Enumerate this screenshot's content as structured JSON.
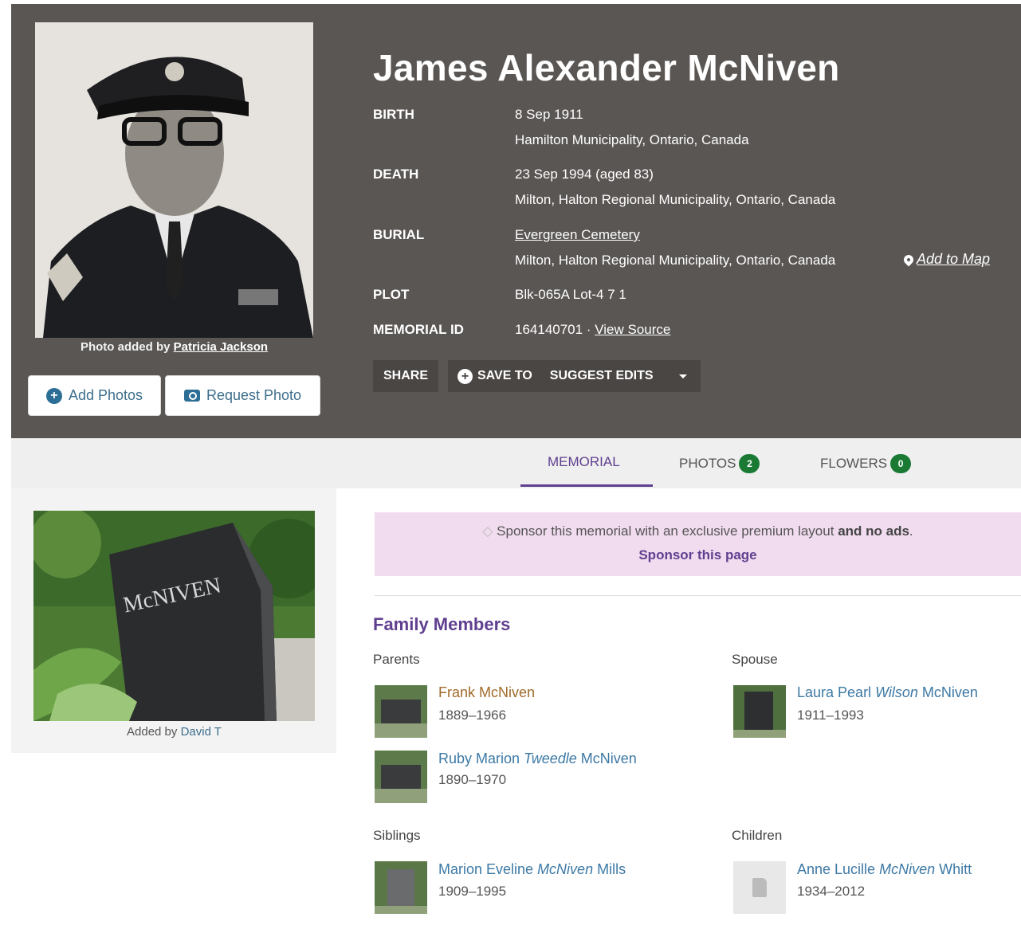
{
  "header": {
    "name": "James Alexander McNiven",
    "photo_credit_prefix": "Photo added by",
    "photo_credit_name": "Patricia Jackson",
    "add_photos_label": "Add Photos",
    "request_photo_label": "Request Photo"
  },
  "facts": {
    "birth_label": "BIRTH",
    "birth_date": "8 Sep 1911",
    "birth_place": "Hamilton Municipality, Ontario, Canada",
    "death_label": "DEATH",
    "death_date": "23 Sep 1994 (aged 83)",
    "death_place": "Milton, Halton Regional Municipality, Ontario, Canada",
    "burial_label": "BURIAL",
    "burial_cemetery": "Evergreen Cemetery",
    "burial_place": "Milton, Halton Regional Municipality, Ontario, Canada",
    "add_to_map": "Add to Map",
    "plot_label": "PLOT",
    "plot_value": "Blk-065A Lot-4 7 1",
    "memorial_id_label": "MEMORIAL ID",
    "memorial_id": "164140701 ·",
    "view_source": "View Source"
  },
  "actions": {
    "share": "SHARE",
    "save_to": "SAVE TO",
    "suggest_edits": "SUGGEST EDITS"
  },
  "tabs": [
    {
      "label": "MEMORIAL",
      "badge": null
    },
    {
      "label": "PHOTOS",
      "badge": "2"
    },
    {
      "label": "FLOWERS",
      "badge": "0"
    }
  ],
  "grave": {
    "credit_prefix": "Added by",
    "credit_name": "David T"
  },
  "sponsor": {
    "text": "Sponsor this memorial with an exclusive premium layout",
    "text_bold": "and no ads",
    "text_end": ".",
    "link": "Sponsor this page"
  },
  "family": {
    "title": "Family Members",
    "parents_label": "Parents",
    "spouse_label": "Spouse",
    "siblings_label": "Siblings",
    "children_label": "Children",
    "parents": [
      {
        "first": "Frank McNiven",
        "maiden": "",
        "last": "",
        "years": "1889–1966"
      },
      {
        "first": "Ruby Marion ",
        "maiden": "Tweedle",
        "last": " McNiven",
        "years": "1890–1970"
      }
    ],
    "spouse": [
      {
        "first": "Laura Pearl ",
        "maiden": "Wilson",
        "last": " McNiven",
        "years": "1911–1993"
      }
    ],
    "siblings": [
      {
        "first": "Marion Eveline ",
        "maiden": "McNiven",
        "last": " Mills",
        "years": "1909–1995"
      }
    ],
    "children": [
      {
        "first": "Anne Lucille ",
        "maiden": "McNiven",
        "last": " Whitt",
        "years": "1934–2012"
      }
    ]
  }
}
